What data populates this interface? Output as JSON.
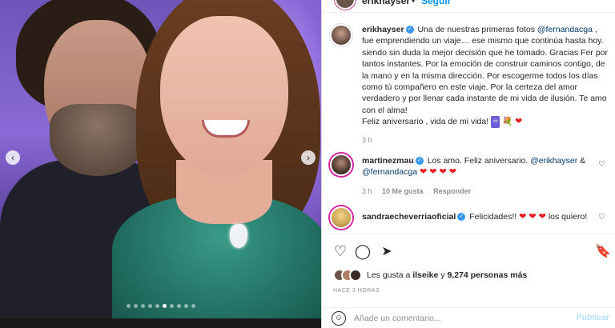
{
  "header": {
    "username": "erikhayser",
    "separator": "•",
    "follow_label": "Seguir"
  },
  "caption": {
    "username": "erikhayser",
    "verified_glyph": "✓",
    "text_part1": "Una de nuestras primeras fotos",
    "mention": "@fernandacga",
    "text_part2": ", fue emprendiendo un viaje… ese mismo que continúa hasta hoy. siendo sin duda la mejor decisión que he tomado. Gracias Fer por tantos instantes. Por la emoción de construir caminos contigo, de la mano y en la misma dirección. Por escogerme todos los días como tú compañero en este viaje. Por la certeza del amor verdadero y por llenar cada instante de mi vida de ilusión. Te amo con el alma!",
    "text_part3": "Feliz aniversario , vida de mi vida!",
    "emoji_infinity": "♾",
    "emoji_flower": "💐",
    "emoji_heart": "❤",
    "time": "3 h"
  },
  "comments": [
    {
      "username": "martinezmau",
      "verified_glyph": "✓",
      "text": "Los amo. Feliz aniversario.",
      "mention1": "@erikhayser",
      "amp": "&",
      "mention2": "@fernandacga",
      "hearts": "❤ ❤ ❤ ❤",
      "time": "3 h",
      "likes": "10 Me gusta",
      "reply": "Responder",
      "like_icon": "♡"
    },
    {
      "username": "sandraecheverriaoficial",
      "verified_glyph": "✓",
      "text": "Felicidades!!",
      "hearts": "❤ ❤ ❤",
      "text_after": "los quiero!",
      "like_icon": "♡"
    }
  ],
  "actions": {
    "like_icon": "♡",
    "comment_icon": "◯",
    "share_icon": "➤",
    "save_icon": "🔖"
  },
  "likes": {
    "prefix": "Les gusta a",
    "user": "ilseike",
    "middle": "y",
    "count": "9,274 personas más"
  },
  "post_time": "HACE 3 HORAS",
  "add_comment": {
    "emoji_icon": "☺",
    "placeholder": "Añade un comentario...",
    "publish_label": "Publicar"
  },
  "carousel": {
    "prev": "‹",
    "next": "›",
    "total_dots": 10,
    "active_dot": 5
  }
}
